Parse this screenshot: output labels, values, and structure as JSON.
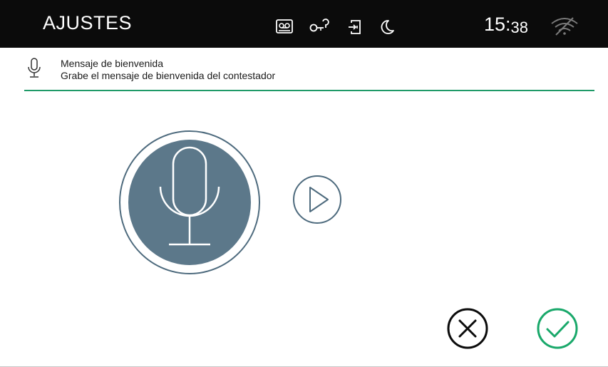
{
  "header": {
    "title": "AJUSTES",
    "clock_hours": "15:",
    "clock_minutes": "38",
    "status_icons": [
      "voicemail-icon",
      "key-icon",
      "door-exit-icon",
      "moon-icon"
    ],
    "wifi_icon": "wifi-off-icon"
  },
  "subheader": {
    "icon": "microphone-icon",
    "title": "Mensaje de bienvenida",
    "description": "Grabe el mensaje de bienvenida del contestador"
  },
  "controls": {
    "record_icon": "microphone-icon",
    "play_icon": "play-icon",
    "cancel_icon": "cancel-icon",
    "confirm_icon": "confirm-icon"
  },
  "colors": {
    "topbar": "#0b0b0b",
    "accent": "#1f9a68",
    "record_fill": "#5c788a",
    "record_ring": "#4d6a7d",
    "confirm": "#19a86a"
  }
}
